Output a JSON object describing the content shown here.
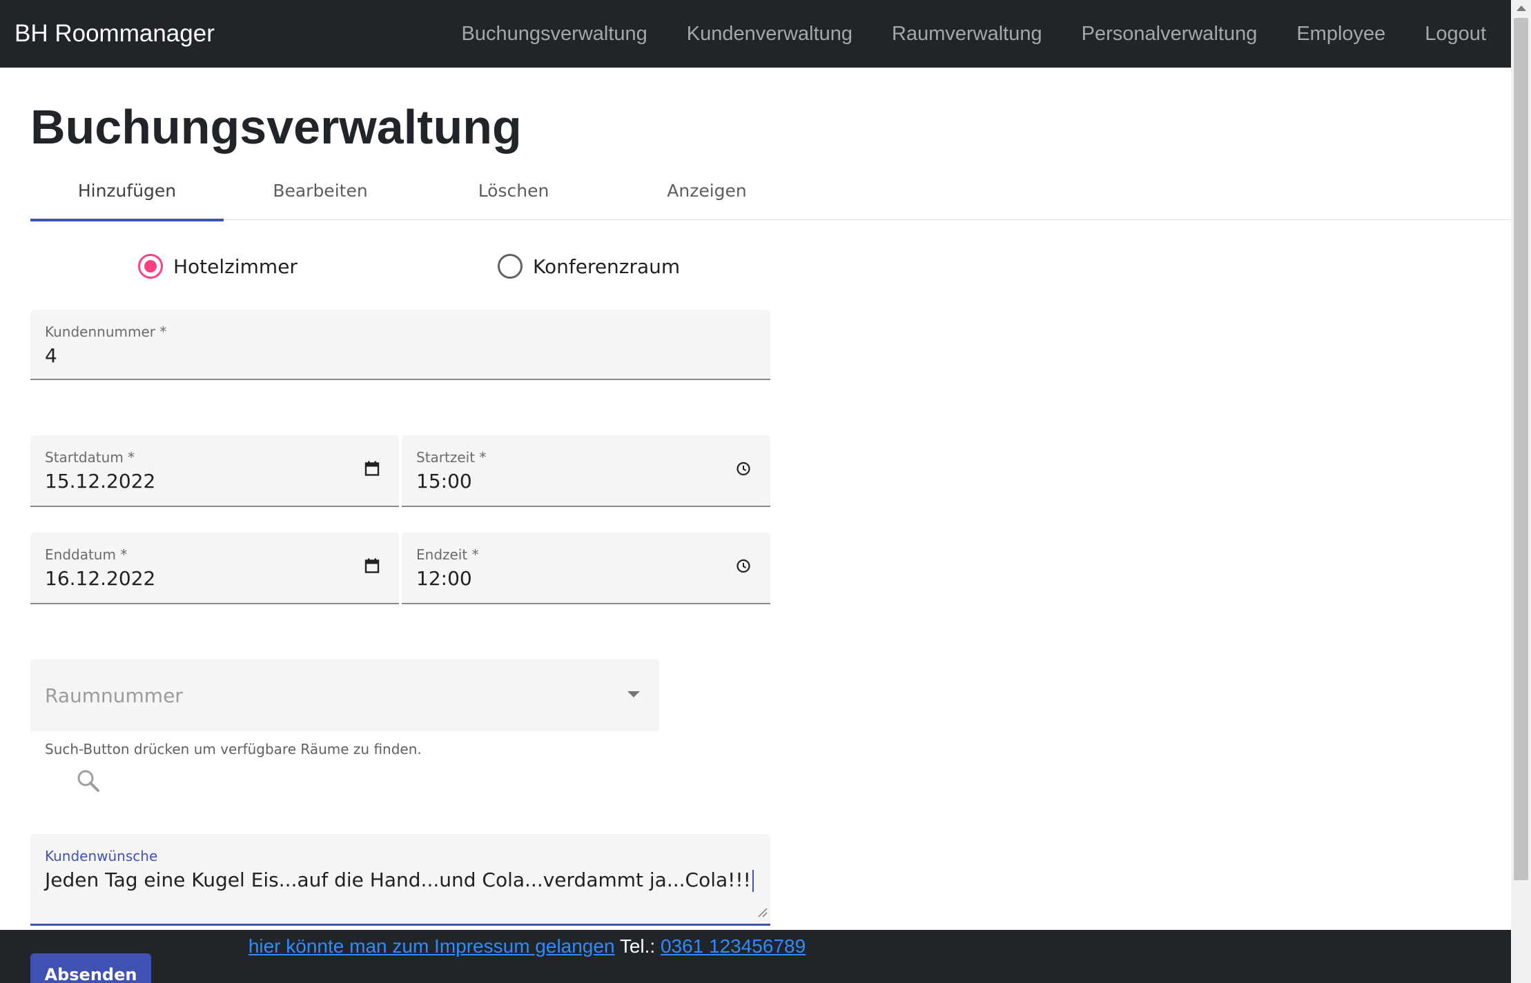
{
  "navbar": {
    "brand": "BH Roommanager",
    "links": [
      "Buchungsverwaltung",
      "Kundenverwaltung",
      "Raumverwaltung",
      "Personalverwaltung",
      "Employee",
      "Logout"
    ]
  },
  "page": {
    "title": "Buchungsverwaltung"
  },
  "tabs": {
    "items": [
      "Hinzufügen",
      "Bearbeiten",
      "Löschen",
      "Anzeigen"
    ],
    "active": "Hinzufügen"
  },
  "room_type": {
    "options": [
      "Hotelzimmer",
      "Konferenzraum"
    ],
    "selected": "Hotelzimmer"
  },
  "form": {
    "customer_number": {
      "label": "Kundennummer *",
      "value": "4"
    },
    "start_date": {
      "label": "Startdatum *",
      "value": "15.12.2022"
    },
    "start_time": {
      "label": "Startzeit *",
      "value": "15:00"
    },
    "end_date": {
      "label": "Enddatum *",
      "value": "16.12.2022"
    },
    "end_time": {
      "label": "Endzeit *",
      "value": "12:00"
    },
    "room_number": {
      "placeholder": "Raumnummer"
    },
    "search_hint": "Such-Button drücken um verfügbare Räume zu finden.",
    "wishes": {
      "label": "Kundenwünsche",
      "value": "Jeden Tag eine Kugel Eis...auf die Hand...und Cola...verdammt ja...Cola!!!"
    },
    "submit_label": "Absenden"
  },
  "footer": {
    "impressum_link": "hier könnte man zum Impressum gelangen",
    "tel_label": "Tel.:",
    "tel_number": "0361 123456789"
  },
  "colors": {
    "navbar_bg": "#212529",
    "primary": "#3f51b5",
    "radio_accent": "#ff4081",
    "link": "#2d8cff"
  },
  "icons": [
    "calendar-icon",
    "clock-icon",
    "search-icon",
    "dropdown-arrow-icon",
    "resize-handle-icon"
  ]
}
